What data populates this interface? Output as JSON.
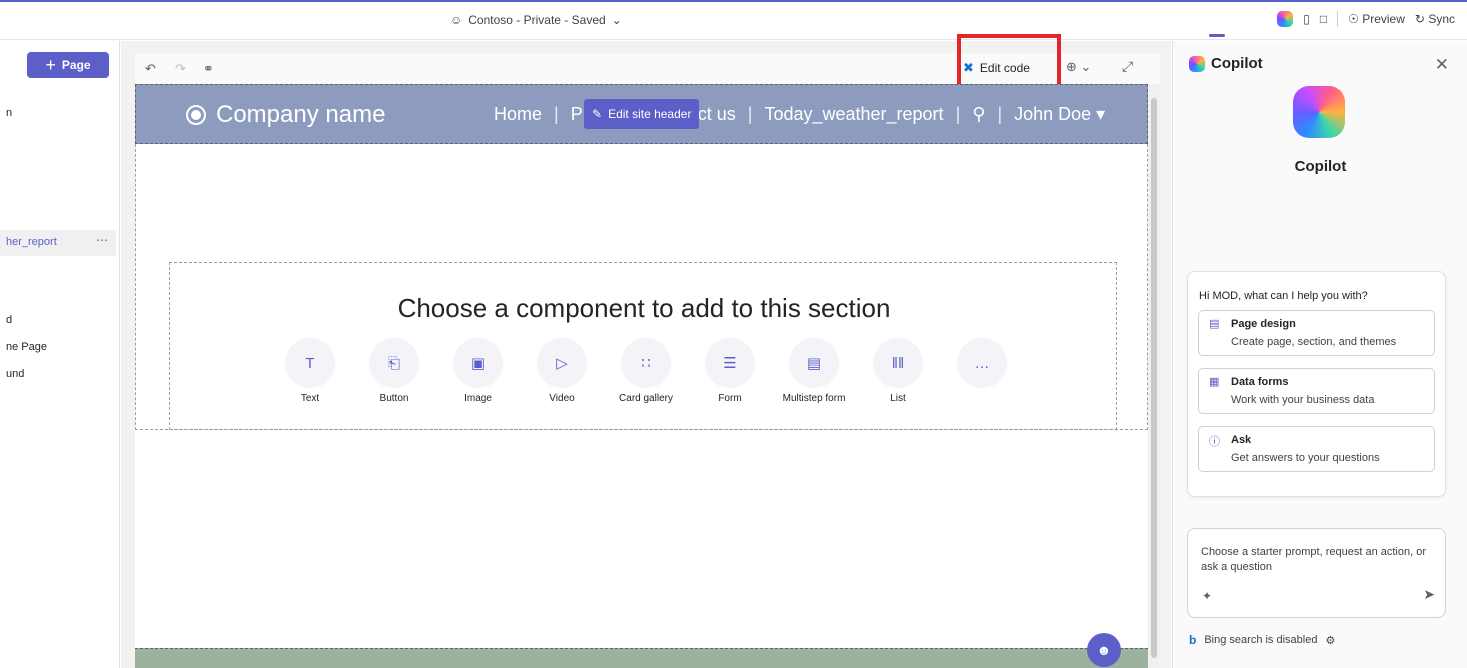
{
  "topbar": {
    "site_status": "Contoso - Private - Saved",
    "preview_label": "Preview",
    "sync_label": "Sync"
  },
  "left_panel": {
    "add_page_label": "Page",
    "items": [
      {
        "text": "n"
      },
      {
        "text": "her_report"
      },
      {
        "text": "d"
      },
      {
        "text": "ne Page"
      },
      {
        "text": "und"
      }
    ],
    "more_label": "⋯"
  },
  "toolbar": {
    "edit_code_label": "Edit code"
  },
  "site": {
    "company_name": "Company name",
    "nav": [
      "Home",
      "|",
      "P",
      "tact us",
      "|",
      "Today_weather_report",
      "|",
      "|",
      "John Doe ▾"
    ],
    "edit_header_label": "Edit site header",
    "component_title": "Choose a component to add to this section",
    "components": [
      {
        "label": "Text",
        "icon": "text-icon",
        "glyph": "T"
      },
      {
        "label": "Button",
        "icon": "button-icon",
        "glyph": "⎗"
      },
      {
        "label": "Image",
        "icon": "image-icon",
        "glyph": "▣"
      },
      {
        "label": "Video",
        "icon": "video-icon",
        "glyph": "▷"
      },
      {
        "label": "Card gallery",
        "icon": "card-gallery-icon",
        "glyph": "∷"
      },
      {
        "label": "Form",
        "icon": "form-icon",
        "glyph": "☰"
      },
      {
        "label": "Multistep form",
        "icon": "multistep-form-icon",
        "glyph": "▤"
      },
      {
        "label": "List",
        "icon": "list-icon",
        "glyph": "‖‖"
      },
      {
        "label": "",
        "icon": "more-icon",
        "glyph": "…"
      }
    ]
  },
  "copilot": {
    "header": "Copilot",
    "name": "Copilot",
    "greeting": "Hi MOD, what can I help you with?",
    "options": [
      {
        "title": "Page design",
        "desc": "Create page, section, and themes",
        "icon": "page-design-icon"
      },
      {
        "title": "Data forms",
        "desc": "Work with your business data",
        "icon": "data-forms-icon"
      },
      {
        "title": "Ask",
        "desc": "Get answers to your questions",
        "icon": "ask-icon"
      }
    ],
    "input_placeholder": "Choose a starter prompt, request an action, or ask a question",
    "bing_status": "Bing search is disabled"
  },
  "colors": {
    "accent": "#5b5fc7",
    "header_bg": "#8d9bbf",
    "highlight": "#e3262b"
  }
}
